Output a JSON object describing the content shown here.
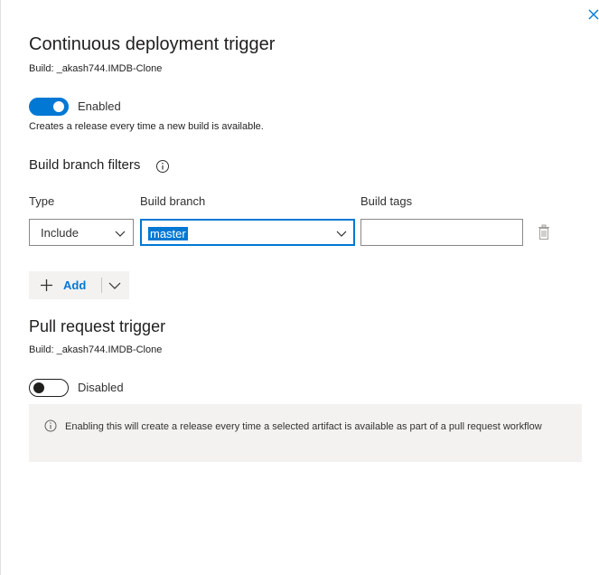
{
  "cd_trigger": {
    "title": "Continuous deployment trigger",
    "build": "Build: _akash744.IMDB-Clone",
    "toggle_state": "Enabled",
    "description": "Creates a release every time a new build is available."
  },
  "filters": {
    "title": "Build branch filters",
    "columns": {
      "type": "Type",
      "branch": "Build branch",
      "tags": "Build tags"
    },
    "row": {
      "type_value": "Include",
      "branch_value": "master",
      "tags_value": ""
    },
    "add_label": "Add"
  },
  "pr_trigger": {
    "title": "Pull request trigger",
    "build": "Build: _akash744.IMDB-Clone",
    "toggle_state": "Disabled",
    "info": "Enabling this will create a release every time a selected artifact is available as part of a pull request workflow"
  },
  "icons": {
    "close": "close-icon",
    "info": "info-icon",
    "chevron": "chevron-down-icon",
    "trash": "trash-icon",
    "plus": "plus-icon"
  },
  "colors": {
    "accent": "#0078d4",
    "text": "#323130",
    "panel_bg": "#f3f2f1"
  }
}
